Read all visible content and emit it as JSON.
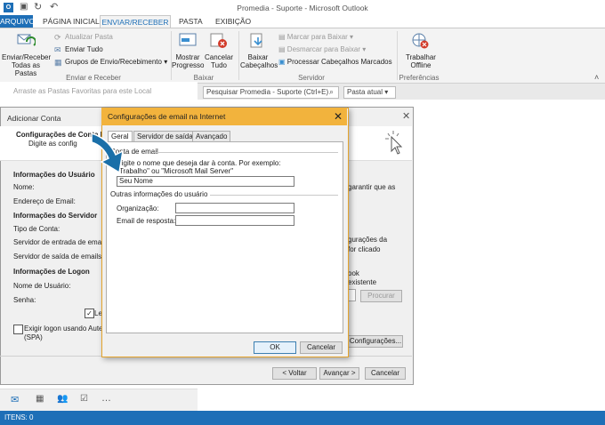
{
  "window": {
    "title": "Promedia - Suporte - Microsoft Outlook"
  },
  "tabs": [
    "ARQUIVO",
    "PÁGINA INICIAL",
    "ENVIAR/RECEBER",
    "PASTA",
    "EXIBIÇÃO"
  ],
  "ribbon": {
    "send_receive_all_l1": "Enviar/Receber",
    "send_receive_all_l2": "Todas as Pastas",
    "update_folder": "Atualizar Pasta",
    "send_all": "Enviar Tudo",
    "send_receive_groups": "Grupos de Envio/Recebimento",
    "group_send_receive": "Enviar e Receber",
    "show_progress_l1": "Mostrar",
    "show_progress_l2": "Progresso",
    "cancel_all_l1": "Cancelar",
    "cancel_all_l2": "Tudo",
    "group_download": "Baixar",
    "download_headers_l1": "Baixar",
    "download_headers_l2": "Cabeçalhos",
    "mark_to_download": "Marcar para Baixar",
    "unmark_to_download": "Desmarcar para Baixar",
    "process_marked_headers": "Processar Cabeçalhos Marcados",
    "group_server": "Servidor",
    "work_offline_l1": "Trabalhar",
    "work_offline_l2": "Offline",
    "group_preferences": "Preferências"
  },
  "left_pane": {
    "favorites_hint": "Arraste as Pastas Favoritas para este Local"
  },
  "search": {
    "placeholder": "Pesquisar Promedia - Suporte (Ctrl+E)",
    "scope": "Pasta atual"
  },
  "account_dialog": {
    "title": "Adicionar Conta",
    "header": "Configurações de Conta PO",
    "subheader": "Digite as config",
    "user_info": "Informações do Usuário",
    "name_label": "Nome:",
    "email_label": "Endereço de Email:",
    "server_info": "Informações do Servidor",
    "account_type": "Tipo de Conta:",
    "incoming_server": "Servidor de entrada de emails:",
    "outgoing_server": "Servidor de saída de emails (SN",
    "logon_info": "Informações de Logon",
    "username_label": "Nome de Usuário:",
    "password_label": "Senha:",
    "remember_fragment": "Le",
    "spa_l1": "Exigir logon usando Auten",
    "spa_l2": "(SPA)",
    "right_text_1": "garantir que as",
    "right_text_2": "gurações da",
    "right_text_3": "for clicado",
    "right_text_4": "ook",
    "right_text_5": "existente",
    "browse_button": "Procurar",
    "more_settings_button": "Configurações...",
    "back_button": "< Voltar",
    "next_button": "Avançar >",
    "cancel_button": "Cancelar"
  },
  "internet_email_dialog": {
    "title": "Configurações de email na Internet",
    "tabs": [
      "Geral",
      "Servidor de saída",
      "Avançado"
    ],
    "section_email": "Conta de email",
    "instruction_l1": "Digite o nome que deseja dar à conta. Por exemplo:",
    "instruction_l2": "\"Trabalho\" ou \"Microsoft Mail Server\"",
    "account_name_value": "Seu Nome",
    "section_other": "Outras informações do usuário",
    "organization_label": "Organização:",
    "organization_value": "",
    "reply_email_label": "Email de resposta:",
    "reply_email_value": "",
    "ok_button": "OK",
    "cancel_button": "Cancelar"
  },
  "status": {
    "items": "ITENS: 0"
  },
  "colors": {
    "accent": "#1e6fb7",
    "dialog_title": "#f2b33d",
    "arrow": "#1a6fa8"
  }
}
